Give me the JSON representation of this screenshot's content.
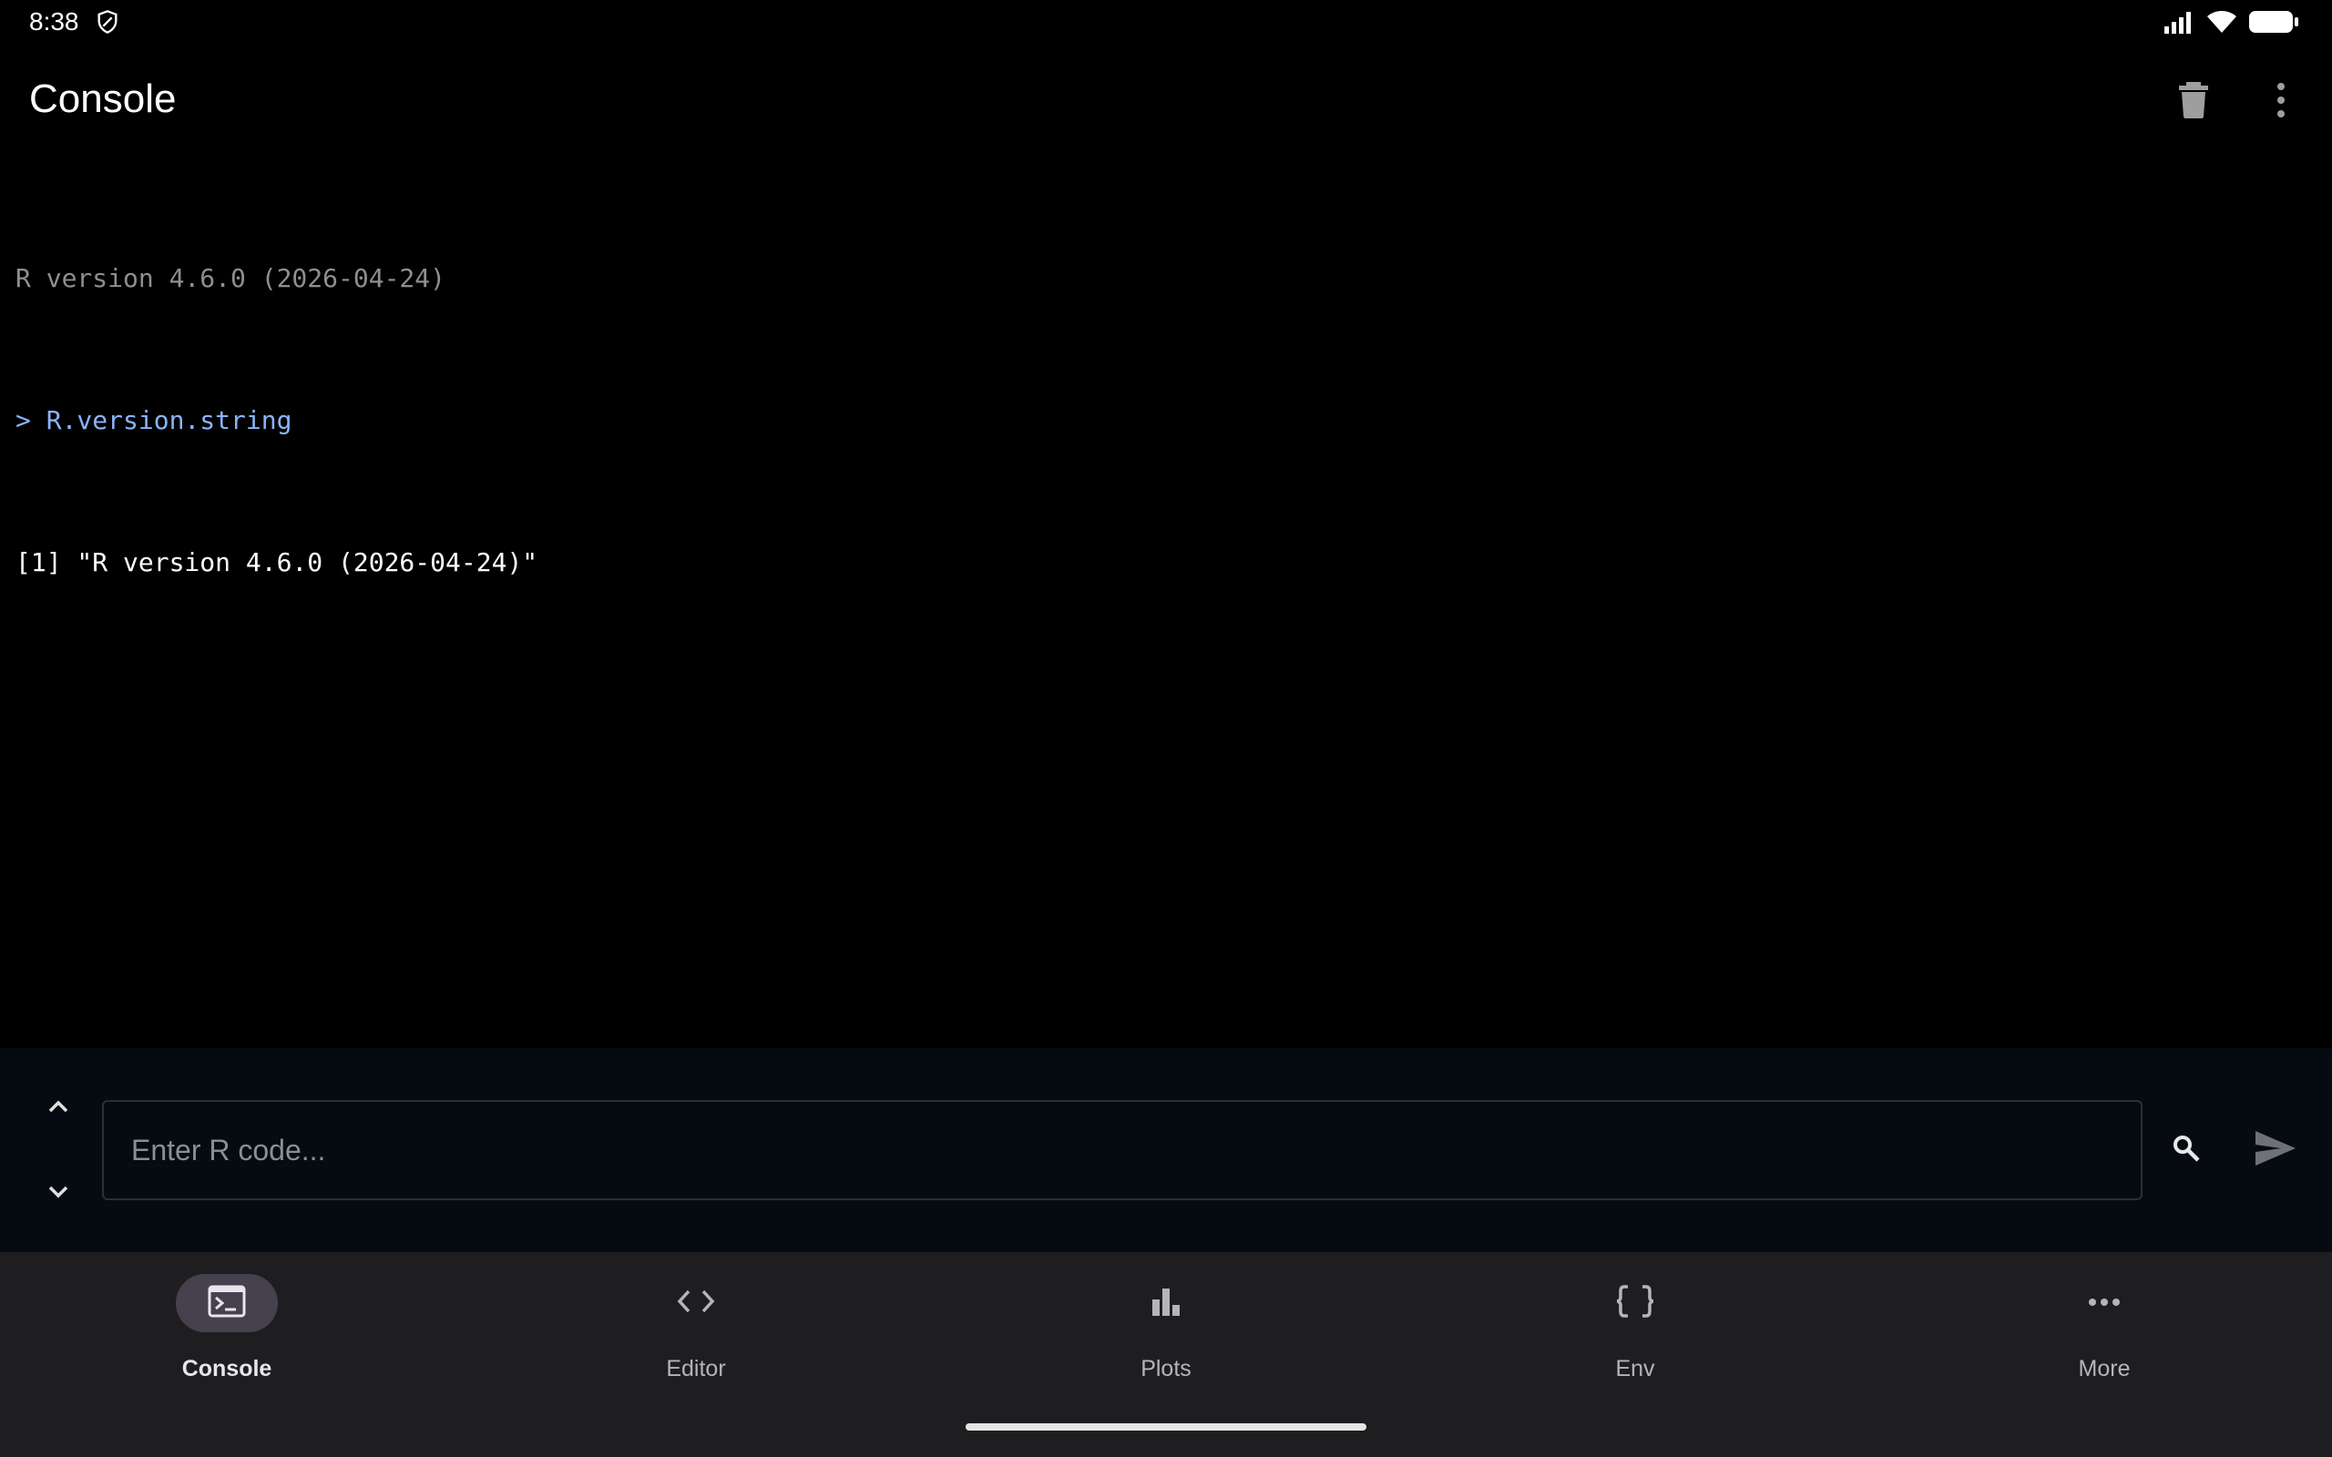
{
  "status_bar": {
    "time": "8:38",
    "icons": [
      "shield-icon",
      "signal-icon",
      "wifi-icon",
      "battery-icon"
    ]
  },
  "app_bar": {
    "title": "Console",
    "actions": [
      "delete-icon",
      "more-vert-icon"
    ]
  },
  "console": {
    "lines": [
      {
        "type": "banner",
        "text": "R version 4.6.0 (2026-04-24)"
      },
      {
        "type": "input",
        "text": "> R.version.string"
      },
      {
        "type": "output",
        "text": "[1] \"R version 4.6.0 (2026-04-24)\""
      }
    ]
  },
  "input": {
    "placeholder": "Enter R code...",
    "value": ""
  },
  "bottom_nav": {
    "items": [
      {
        "label": "Console",
        "icon": "terminal-icon",
        "active": true
      },
      {
        "label": "Editor",
        "icon": "code-icon",
        "active": false
      },
      {
        "label": "Plots",
        "icon": "bar-chart-icon",
        "active": false
      },
      {
        "label": "Env",
        "icon": "braces-icon",
        "active": false
      },
      {
        "label": "More",
        "icon": "more-horiz-icon",
        "active": false
      }
    ]
  },
  "colors": {
    "background": "#000000",
    "input_area": "#060b12",
    "nav_background": "#1e1e20",
    "active_pill": "#46404f",
    "prompt_blue": "#8ab4f8",
    "banner_gray": "#8e8e93"
  }
}
